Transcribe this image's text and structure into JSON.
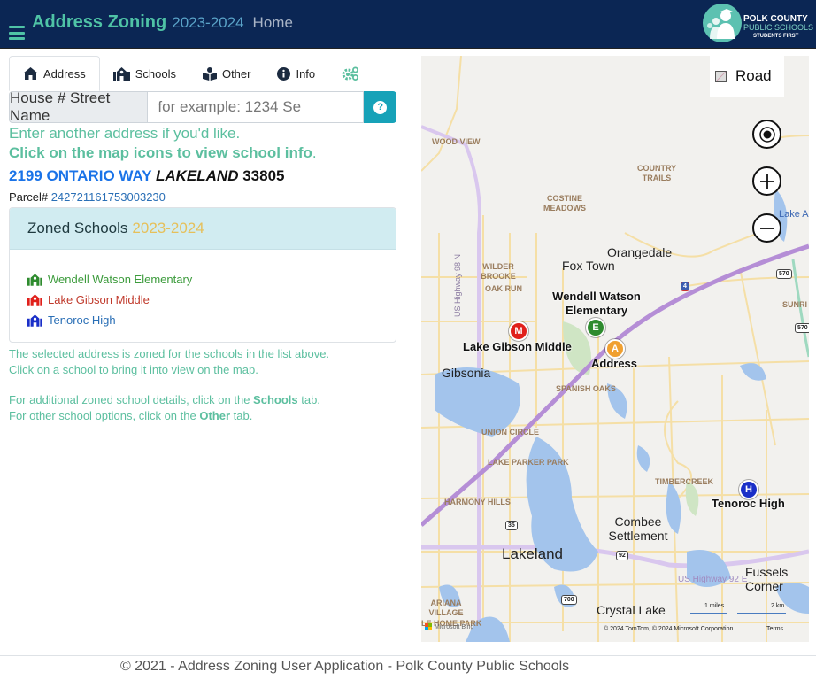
{
  "header": {
    "title": "Address Zoning",
    "year": "2023-2024",
    "home_link": "Home",
    "logo": {
      "line1": "POLK COUNTY",
      "line2": "PUBLIC SCHOOLS",
      "line3": "STUDENTS FIRST"
    }
  },
  "tabs": [
    {
      "label": "Address",
      "icon": "home-icon",
      "active": true
    },
    {
      "label": "Schools",
      "icon": "school-icon",
      "active": false
    },
    {
      "label": "Other",
      "icon": "book-reader-icon",
      "active": false
    },
    {
      "label": "Info",
      "icon": "info-circle-icon",
      "active": false
    },
    {
      "label": "",
      "icon": "cogs-icon",
      "active": false
    }
  ],
  "search": {
    "label": "House # Street Name",
    "placeholder": "for example: 1234 Se",
    "value": "",
    "help_icon": "question-circle-icon"
  },
  "hints": {
    "line1": "Enter another address if you'd like.",
    "line2": "Click on the map icons to view school info",
    "line2_end": "."
  },
  "address": {
    "street": "2199 ONTARIO WAY",
    "city": "LAKELAND",
    "zip": "33805",
    "parcel_label": "Parcel#",
    "parcel_number": "242721161753003230"
  },
  "zoned_schools": {
    "title": "Zoned Schools",
    "year": "2023-2024",
    "schools": [
      {
        "name": "Wendell Watson Elementary",
        "color": "#3c9b3c",
        "icon_color": "#2e8b2e"
      },
      {
        "name": "Lake Gibson Middle",
        "color": "#c0392b",
        "icon_color": "#e0201b"
      },
      {
        "name": "Tenoroc High",
        "color": "#2a6fb6",
        "icon_color": "#1a2fc8"
      }
    ]
  },
  "info": {
    "p1_line1": "The selected address is zoned for the schools in the list above.",
    "p1_line2": "Click on a school to bring it into view on the map.",
    "p2_line1_pre": "For additional zoned school details, click on the ",
    "p2_line1_bold": "Schools",
    "p2_line1_post": " tab.",
    "p2_line2_pre": "For other school options, click on the ",
    "p2_line2_bold": "Other",
    "p2_line2_post": " tab."
  },
  "map": {
    "style_button": "Road",
    "controls": [
      "locate-me",
      "zoom-in",
      "zoom-out"
    ],
    "neighborhoods": [
      "WOOD VIEW",
      "COUNTRY TRAILS",
      "COSTINE MEADOWS",
      "WILDER BROOKE",
      "OAK RUN",
      "SPANISH OAKS",
      "UNION CIRCLE",
      "LAKE PARKER PARK",
      "TIMBERCREEK",
      "HARMONY HILLS",
      "ARIANA VILLAGE",
      "LE HOME PARK",
      "SUNRI"
    ],
    "towns": [
      "Orangedale",
      "Fox Town",
      "Gibsonia",
      "Combee Settlement",
      "Lakeland",
      "Fussels Corner",
      "Crystal Lake",
      "Lake A"
    ],
    "roads": [
      "US Highway 98 N",
      "US Highway 92 E"
    ],
    "shields": [
      "4",
      "570",
      "570",
      "35",
      "92",
      "700"
    ],
    "markers": [
      {
        "letter": "E",
        "label": "Wendell Watson Elementary",
        "color": "#2e8b2e"
      },
      {
        "letter": "M",
        "label": "Lake Gibson Middle",
        "color": "#e0201b"
      },
      {
        "letter": "A",
        "label": "Address",
        "color": "#f0a030"
      },
      {
        "letter": "H",
        "label": "Tenoroc High",
        "color": "#1a2fc8"
      }
    ],
    "scale": {
      "miles": "1 miles",
      "km": "2 km"
    },
    "attribution": "© 2024 TomTom, © 2024 Microsoft Corporation",
    "terms": "Terms",
    "provider": "Microsoft Bing"
  },
  "footer": {
    "text": "© 2021 - Address Zoning User Application - Polk County Public Schools"
  }
}
